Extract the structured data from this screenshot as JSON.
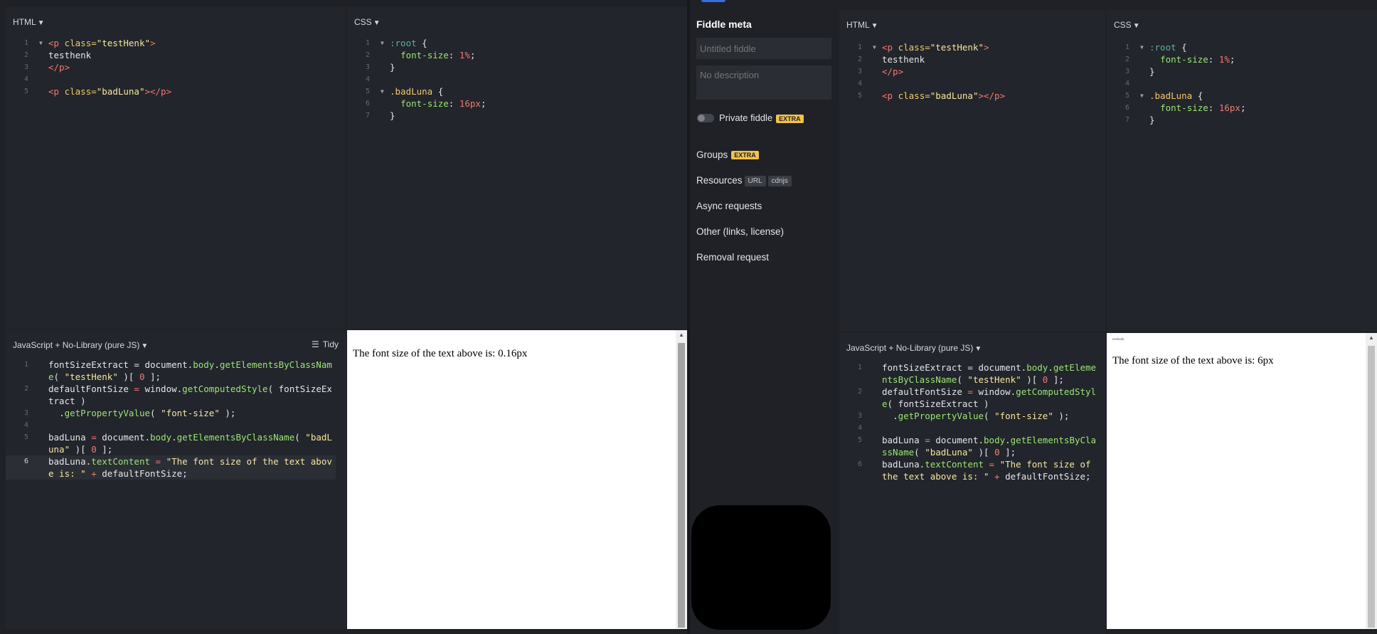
{
  "left": {
    "html_panel": {
      "label": "HTML",
      "lines": [
        {
          "n": "1",
          "fold": true
        },
        {
          "n": "2"
        },
        {
          "n": "3"
        },
        {
          "n": "4"
        },
        {
          "n": "5"
        }
      ]
    },
    "css_panel": {
      "label": "CSS"
    },
    "js_panel": {
      "label": "JavaScript + No-Library (pure JS)",
      "tidy": "Tidy"
    },
    "result_text": "The font size of the text above is: 0.16px"
  },
  "right": {
    "sidebar": {
      "title": "Fiddle meta",
      "title_placeholder": "Untitled fiddle",
      "description_placeholder": "No description",
      "private_label": "Private fiddle",
      "extra_badge": "EXTRA",
      "groups": "Groups",
      "resources": "Resources",
      "resources_url": "URL",
      "resources_cdnjs": "cdnjs",
      "async": "Async requests",
      "other": "Other (links, license)",
      "removal": "Removal request"
    },
    "html_panel": {
      "label": "HTML"
    },
    "css_panel": {
      "label": "CSS"
    },
    "js_panel": {
      "label": "JavaScript + No-Library (pure JS)"
    },
    "result_small": "testhenk",
    "result_text": "The font size of the text above is: 6px"
  },
  "code": {
    "html_l1_tag_open": "<p",
    "html_l1_attr": " class=",
    "html_l1_str": "\"testHenk\"",
    "html_l1_close": ">",
    "html_l2": "testhenk",
    "html_l3": "</p>",
    "html_l5_tag_open": "<p",
    "html_l5_attr": " class=",
    "html_l5_str": "\"badLuna\"",
    "html_l5_close": "></p>",
    "css_l1_sel": ":root",
    "css_brace_open": " {",
    "css_l2_prop": "font-size",
    "css_colon": ": ",
    "css_l2_val": "1%",
    "css_semi": ";",
    "css_brace_close": "}",
    "css_l5_sel": ".badLuna",
    "css_l6_val": "16px",
    "js_l1a": "fontSizeExtract = document.",
    "js_l1b": "body",
    "js_l1c": ".",
    "js_l1d": "getElementsByClassName",
    "js_l1e": "( ",
    "js_l1f": "\"testHenk\"",
    "js_l1g": " )[ ",
    "js_l1h": "0",
    "js_l1i": " ];",
    "js_l2a": "defaultFontSize ",
    "js_l2b": "=",
    "js_l2c": " window.",
    "js_l2d": "getComputedStyle",
    "js_l2e": "( fontSizeExtract )",
    "js_l3a": "  .",
    "js_l3b": "getPropertyValue",
    "js_l3c": "( ",
    "js_l3d": "\"font-size\"",
    "js_l3e": " );",
    "js_l5a": "badLuna ",
    "js_l5b": "=",
    "js_l5c": " document.",
    "js_l5d": "getElementsByClassName",
    "js_l5f": "\"badLuna\"",
    "js_l6a": "badLuna.",
    "js_l6b": "textContent",
    "js_l6c": " = ",
    "js_l6d": "\"The font size of the text above is: \"",
    "js_l6e": " + ",
    "js_l6f": "defaultFontSize;"
  },
  "colors": {
    "background": "#1f2127",
    "panel": "#22252b",
    "tag": "#f27870",
    "attr": "#f2c96d",
    "string": "#f6e6a0",
    "function": "#9ae675",
    "accent": "#3b6de0",
    "extra_badge": "#f2c14a"
  }
}
